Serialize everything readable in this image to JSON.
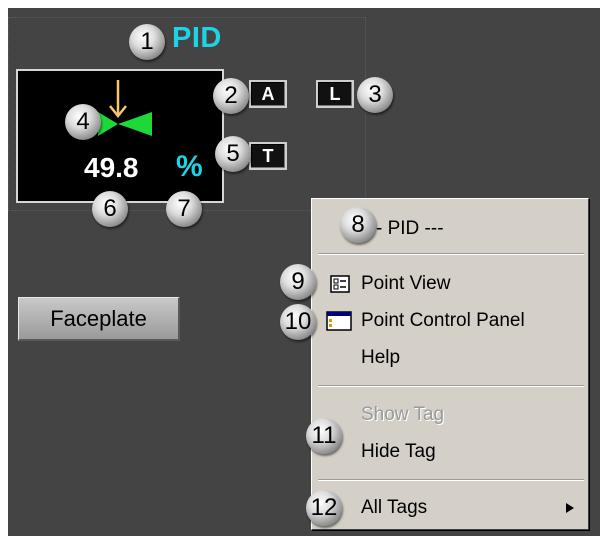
{
  "pid_title": "PID",
  "faceplate_block": {
    "value": "49.8",
    "unit": "%"
  },
  "buttons": {
    "a": "A",
    "l": "L",
    "t": "T",
    "faceplate": "Faceplate"
  },
  "context_menu": {
    "header": "- PID ---",
    "items": [
      {
        "label": "Point View",
        "icon": "point-view-icon"
      },
      {
        "label": "Point Control Panel",
        "icon": "point-control-panel-icon"
      },
      {
        "label": "Help"
      },
      {
        "label": "Show Tag",
        "disabled": true
      },
      {
        "label": "Hide Tag"
      },
      {
        "label": "All Tags",
        "submenu": true
      }
    ]
  },
  "markers": [
    "1",
    "2",
    "3",
    "4",
    "5",
    "6",
    "7",
    "8",
    "9",
    "10",
    "11",
    "12"
  ],
  "colors": {
    "accent_cyan": "#1ed3e6",
    "valve_green": "#1ed838",
    "arrow_yellow": "#f2c86a",
    "background": "#444444",
    "menu_bg": "#d4d0c8"
  }
}
